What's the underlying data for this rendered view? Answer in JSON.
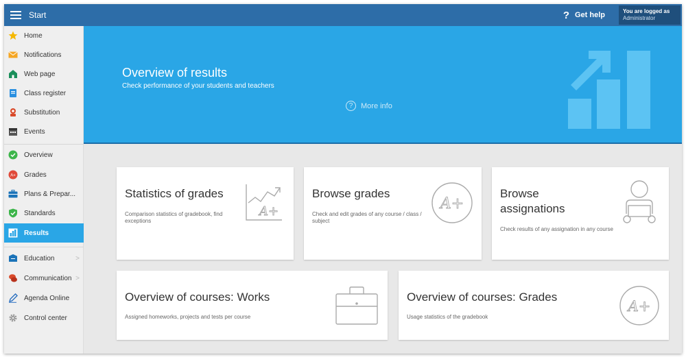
{
  "topbar": {
    "title": "Start",
    "help_label": "Get help",
    "help_glyph": "?",
    "user_line1": "You are logged as",
    "user_line2": "Administrator"
  },
  "sidebar": {
    "items": [
      {
        "label": "Home",
        "icon": "star-icon"
      },
      {
        "label": "Notifications",
        "icon": "envelope-icon"
      },
      {
        "label": "Web page",
        "icon": "house-icon"
      },
      {
        "label": "Class register",
        "icon": "book-icon"
      },
      {
        "label": "Substitution",
        "icon": "person-swap-icon"
      },
      {
        "label": "Events",
        "icon": "calendar-icon"
      },
      {
        "label": "Overview",
        "icon": "check-circle-icon"
      },
      {
        "label": "Grades",
        "icon": "grade-badge-icon"
      },
      {
        "label": "Plans & Prepar...",
        "icon": "briefcase-icon"
      },
      {
        "label": "Standards",
        "icon": "shield-check-icon"
      },
      {
        "label": "Results",
        "icon": "bar-chart-icon",
        "active": true
      },
      {
        "label": "Education",
        "icon": "education-icon",
        "chevron": ">"
      },
      {
        "label": "Communication",
        "icon": "chat-icon",
        "chevron": ">"
      },
      {
        "label": "Agenda Online",
        "icon": "pen-icon"
      },
      {
        "label": "Control center",
        "icon": "gear-icon"
      }
    ]
  },
  "hero": {
    "title": "Overview of results",
    "subtitle": "Check performance of your students and teachers",
    "more_info": "More info",
    "more_info_glyph": "?"
  },
  "cards": {
    "stats": {
      "title": "Statistics of grades",
      "desc": "Comparison statistics of gradebook, find exceptions"
    },
    "browse_grades": {
      "title": "Browse grades",
      "desc": "Check and edit grades of any course / class / subject"
    },
    "browse_assign_line1": "Browse",
    "browse_assign_line2": "assignations",
    "browse_assign_desc": "Check results of any assignation in any course",
    "courses_works": {
      "title": "Overview of courses: Works",
      "desc": "Assigned homeworks, projects and tests per course"
    },
    "courses_grades": {
      "title": "Overview of courses: Grades",
      "desc": "Usage statistics of the gradebook"
    }
  },
  "icon_glyphs": {
    "grade": "A+"
  },
  "colors": {
    "topbar": "#2d6da8",
    "hero": "#2aa6e6",
    "active_item": "#2aa6e6",
    "hero_art": "#5cc3f3"
  }
}
